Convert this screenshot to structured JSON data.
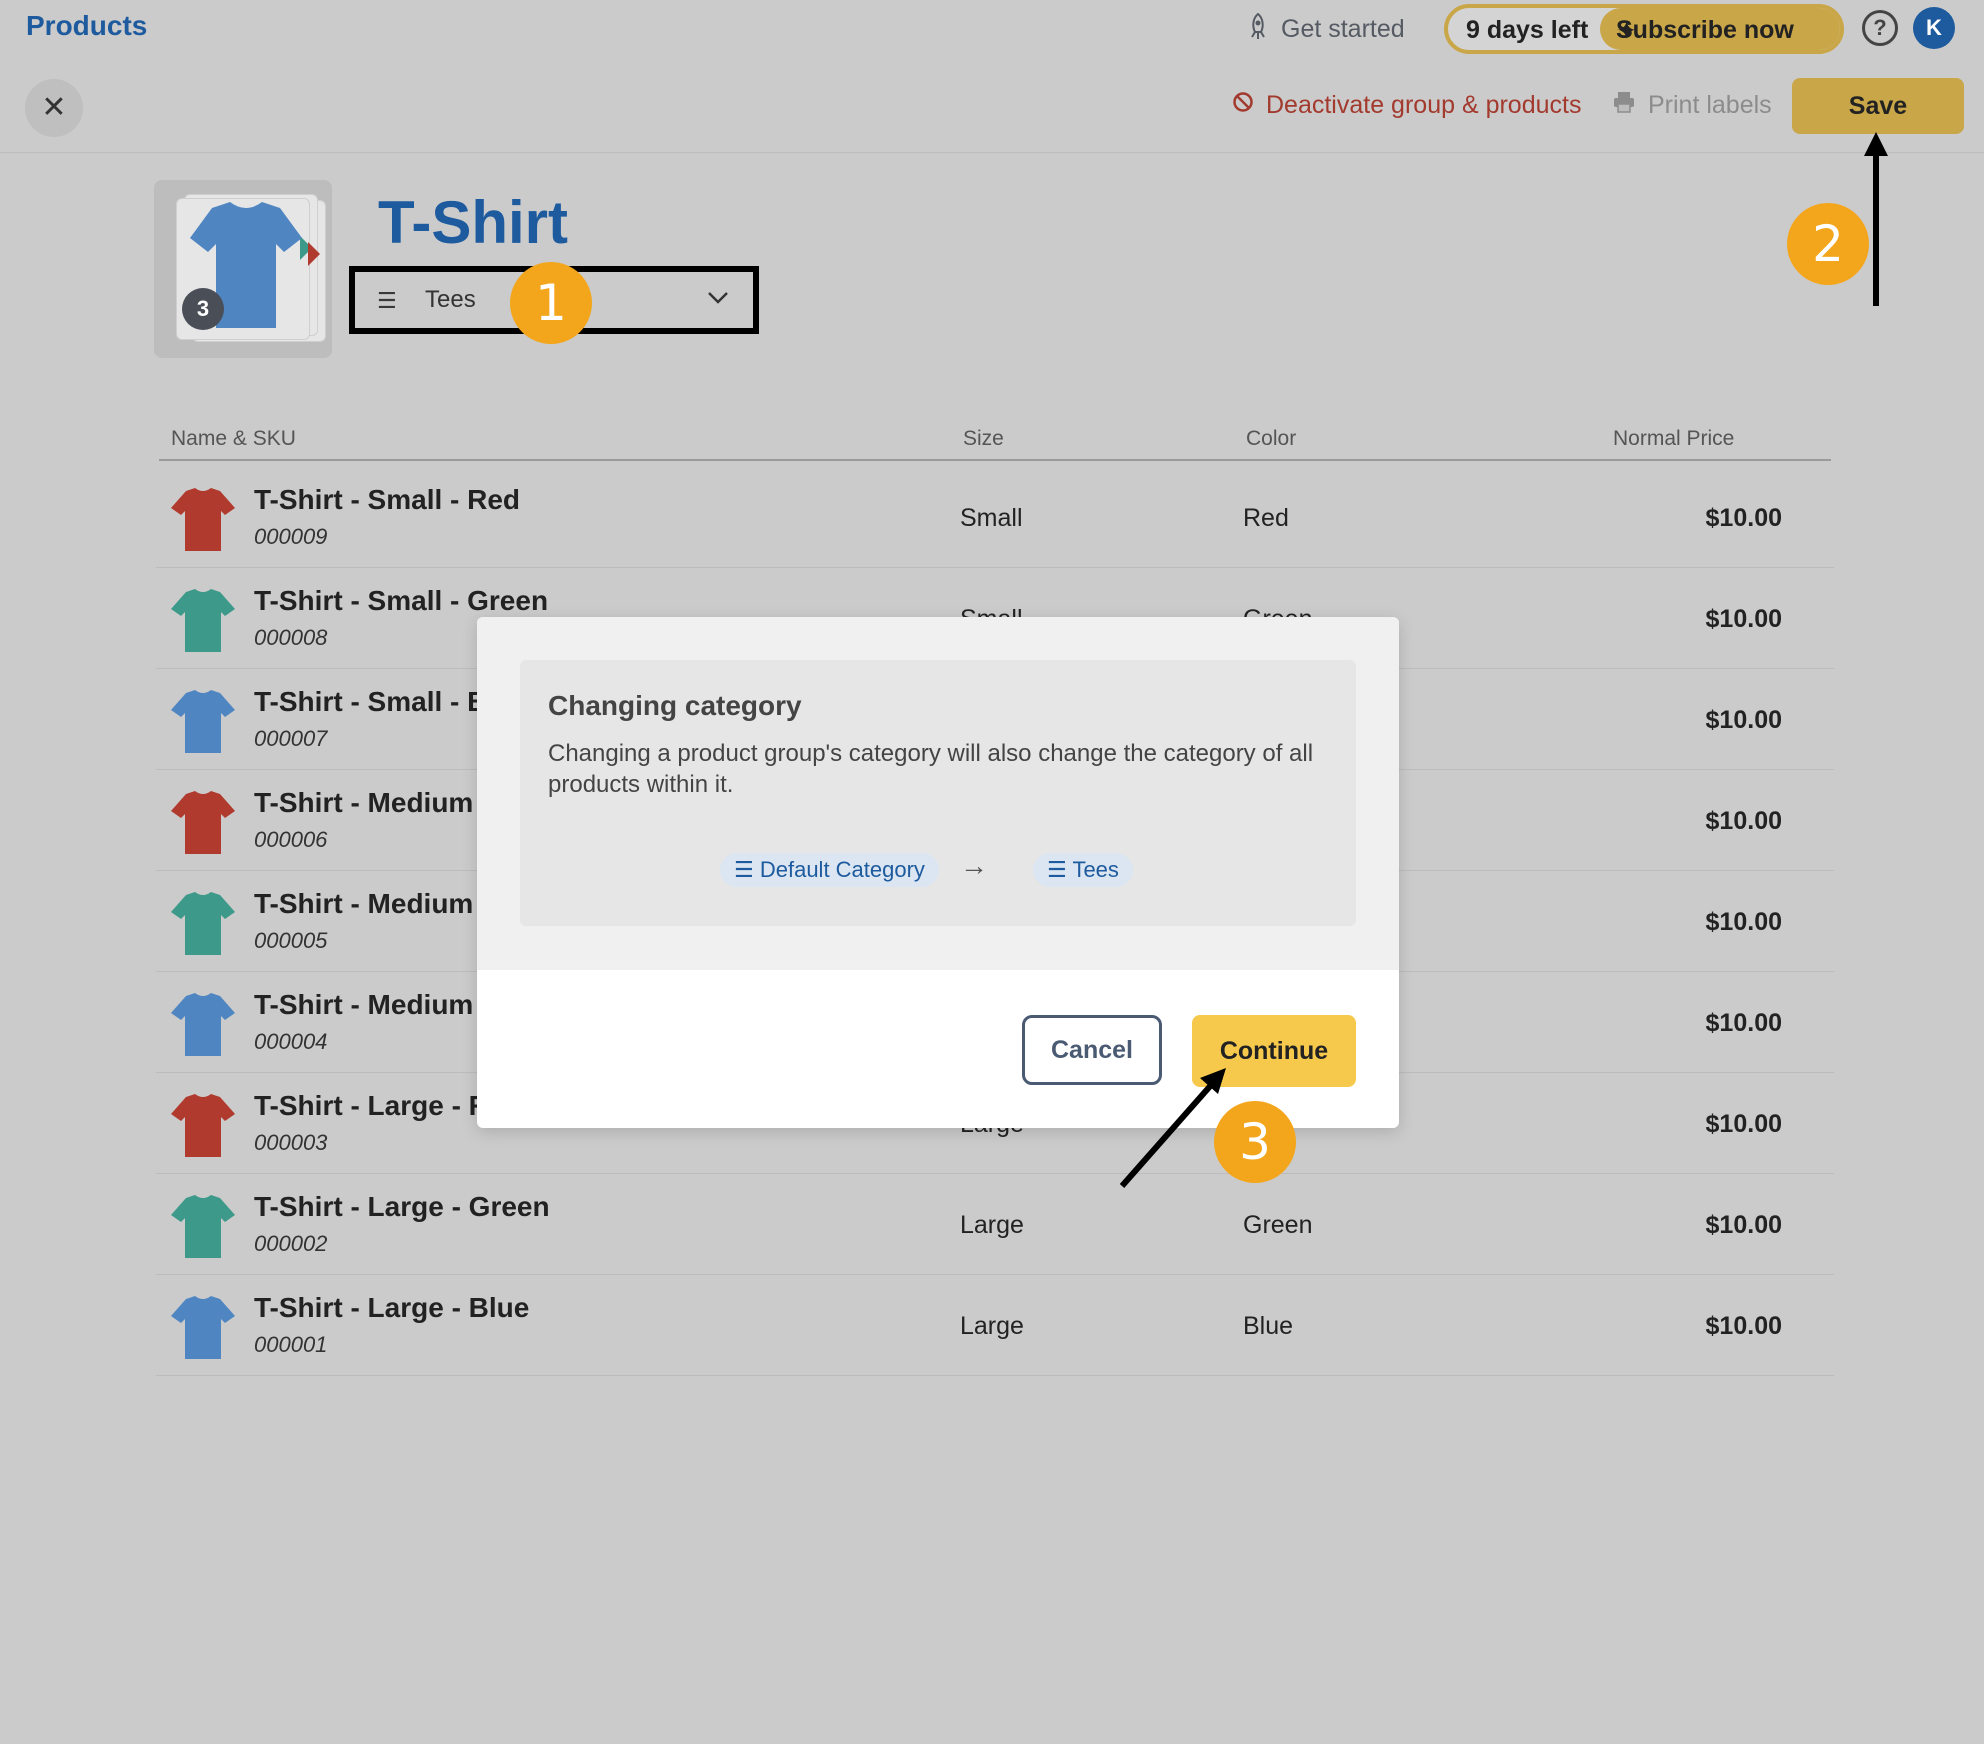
{
  "topbar": {
    "title": "Products",
    "get_started": "Get started",
    "trial_days": "9 days left",
    "subscribe": "Subscribe now",
    "help_glyph": "?",
    "avatar_initial": "K"
  },
  "actions": {
    "close_glyph": "✕",
    "deactivate": "Deactivate group & products",
    "print": "Print labels",
    "save": "Save"
  },
  "product": {
    "title": "T-Shirt",
    "image_count": "3",
    "category": "Tees"
  },
  "table": {
    "headers": [
      "Name & SKU",
      "Size",
      "Color",
      "Normal Price"
    ],
    "rows": [
      {
        "name": "T-Shirt - Small - Red",
        "sku": "000009",
        "size": "Small",
        "color": "Red",
        "price": "$10.00",
        "swatch": "#b03a2e"
      },
      {
        "name": "T-Shirt - Small - Green",
        "sku": "000008",
        "size": "Small",
        "color": "Green",
        "price": "$10.00",
        "swatch": "#3d9a8a"
      },
      {
        "name": "T-Shirt - Small - B",
        "sku": "000007",
        "size": "",
        "color": "",
        "price": "$10.00",
        "swatch": "#4f86c2"
      },
      {
        "name": "T-Shirt - Medium",
        "sku": "000006",
        "size": "",
        "color": "",
        "price": "$10.00",
        "swatch": "#b03a2e"
      },
      {
        "name": "T-Shirt - Medium",
        "sku": "000005",
        "size": "",
        "color": "",
        "price": "$10.00",
        "swatch": "#3d9a8a"
      },
      {
        "name": "T-Shirt - Medium",
        "sku": "000004",
        "size": "",
        "color": "",
        "price": "$10.00",
        "swatch": "#4f86c2"
      },
      {
        "name": "T-Shirt - Large - R",
        "sku": "000003",
        "size": "Large",
        "color": "",
        "price": "$10.00",
        "swatch": "#b03a2e"
      },
      {
        "name": "T-Shirt - Large - Green",
        "sku": "000002",
        "size": "Large",
        "color": "Green",
        "price": "$10.00",
        "swatch": "#3d9a8a"
      },
      {
        "name": "T-Shirt - Large - Blue",
        "sku": "000001",
        "size": "Large",
        "color": "Blue",
        "price": "$10.00",
        "swatch": "#4f86c2"
      }
    ]
  },
  "modal": {
    "title": "Changing category",
    "description": "Changing a product group's category will also change the category of all products within it.",
    "from_category": "Default Category",
    "to_category": "Tees",
    "cancel": "Cancel",
    "continue": "Continue"
  },
  "callouts": {
    "step1": "1",
    "step2": "2",
    "step3": "3"
  },
  "colors": {
    "brand_blue": "#1d5a9e",
    "save_gold": "#c9a647",
    "continue_yellow": "#f6c94c",
    "callout_orange": "#f3a61b",
    "danger_red": "#a33a2e"
  }
}
